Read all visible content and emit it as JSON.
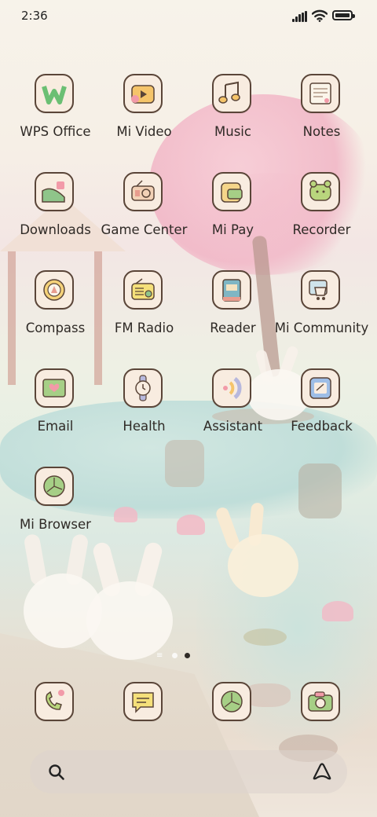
{
  "status_bar": {
    "time": "2:36"
  },
  "apps": [
    {
      "label": "WPS Office",
      "icon": "wps-office-icon"
    },
    {
      "label": "Mi Video",
      "icon": "mi-video-icon"
    },
    {
      "label": "Music",
      "icon": "music-icon"
    },
    {
      "label": "Notes",
      "icon": "notes-icon"
    },
    {
      "label": "Downloads",
      "icon": "downloads-icon"
    },
    {
      "label": "Game Center",
      "icon": "game-center-icon"
    },
    {
      "label": "Mi Pay",
      "icon": "mi-pay-icon"
    },
    {
      "label": "Recorder",
      "icon": "recorder-icon"
    },
    {
      "label": "Compass",
      "icon": "compass-icon"
    },
    {
      "label": "FM Radio",
      "icon": "fm-radio-icon"
    },
    {
      "label": "Reader",
      "icon": "reader-icon"
    },
    {
      "label": "Mi Community",
      "icon": "mi-community-icon"
    },
    {
      "label": "Email",
      "icon": "email-icon"
    },
    {
      "label": "Health",
      "icon": "health-icon"
    },
    {
      "label": "Assistant",
      "icon": "assistant-icon"
    },
    {
      "label": "Feedback",
      "icon": "feedback-icon"
    },
    {
      "label": "Mi Browser",
      "icon": "mi-browser-icon"
    }
  ],
  "page_indicator": {
    "pages": 2,
    "current": 2
  },
  "dock": [
    {
      "icon": "phone-icon"
    },
    {
      "icon": "messages-icon"
    },
    {
      "icon": "browser-icon"
    },
    {
      "icon": "camera-icon"
    }
  ],
  "search_bar": {
    "left_icon": "search-icon",
    "right_icon": "assistant-logo-icon"
  },
  "colors": {
    "icon_border": "#5a4538",
    "icon_bg": "#f8ece0",
    "label": "#2f2a26"
  }
}
